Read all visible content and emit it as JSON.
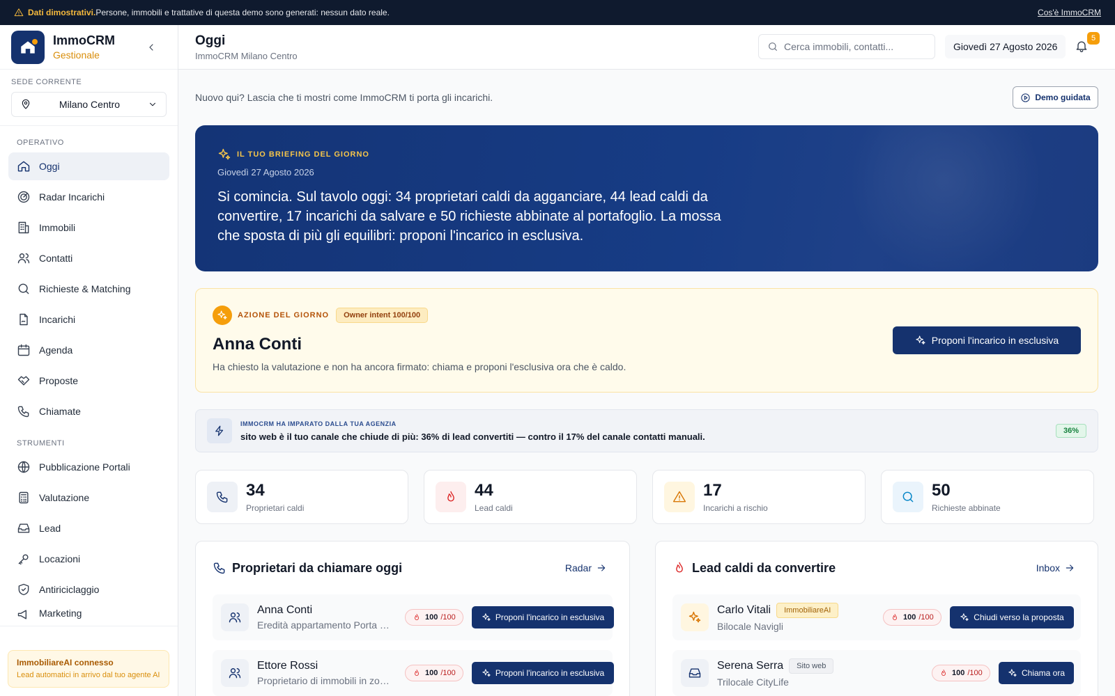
{
  "banner": {
    "strong": "Dati dimostrativi.",
    "text": " Persone, immobili e trattative di questa demo sono generati: nessun dato reale.",
    "link": "Cos'è ImmoCRM"
  },
  "sidebar": {
    "brand_name": "ImmoCRM",
    "brand_sub": "Gestionale",
    "sede_label": "SEDE CORRENTE",
    "sede_value": "Milano Centro",
    "section_operativo": "OPERATIVO",
    "operativo": [
      {
        "label": "Oggi",
        "icon": "home-icon"
      },
      {
        "label": "Radar Incarichi",
        "icon": "radar-icon"
      },
      {
        "label": "Immobili",
        "icon": "building-icon"
      },
      {
        "label": "Contatti",
        "icon": "users-icon"
      },
      {
        "label": "Richieste & Matching",
        "icon": "search-icon"
      },
      {
        "label": "Incarichi",
        "icon": "file-signature-icon"
      },
      {
        "label": "Agenda",
        "icon": "calendar-icon"
      },
      {
        "label": "Proposte",
        "icon": "handshake-icon"
      },
      {
        "label": "Chiamate",
        "icon": "phone-icon"
      }
    ],
    "section_strumenti": "STRUMENTI",
    "strumenti": [
      {
        "label": "Pubblicazione Portali",
        "icon": "globe-icon"
      },
      {
        "label": "Valutazione",
        "icon": "calculator-icon"
      },
      {
        "label": "Lead",
        "icon": "inbox-icon"
      },
      {
        "label": "Locazioni",
        "icon": "key-icon"
      },
      {
        "label": "Antiriciclaggio",
        "icon": "shield-icon"
      },
      {
        "label": "Marketing",
        "icon": "megaphone-icon"
      }
    ],
    "ai_title": "ImmobiliareAI connesso",
    "ai_desc": "Lead automatici in arrivo dal tuo agente AI"
  },
  "header": {
    "title": "Oggi",
    "subtitle": "ImmoCRM Milano Centro",
    "search_placeholder": "Cerca immobili, contatti...",
    "date": "Giovedì 27 Agosto 2026",
    "notifications": "5"
  },
  "intro": {
    "text": "Nuovo qui? Lascia che ti mostri come ImmoCRM ti porta gli incarichi.",
    "demo_button": "Demo guidata"
  },
  "briefing": {
    "label": "IL TUO BRIEFING DEL GIORNO",
    "date": "Giovedì 27 Agosto 2026",
    "text": "Si comincia. Sul tavolo oggi: 34 proprietari caldi da agganciare, 44 lead caldi da convertire, 17 incarichi da salvare e 50 richieste abbinate al portafoglio. La mossa che sposta di più gli equilibri: proponi l'incarico in esclusiva."
  },
  "azione": {
    "label": "AZIONE DEL GIORNO",
    "pill": "Owner intent 100/100",
    "name": "Anna Conti",
    "desc": "Ha chiesto la valutazione e non ha ancora firmato: chiama e proponi l'esclusiva ora che è caldo.",
    "button": "Proponi l'incarico in esclusiva"
  },
  "learn": {
    "label": "IMMOCRM HA IMPARATO DALLA TUA AGENZIA",
    "text": "sito web è il tuo canale che chiude di più: 36% di lead convertiti — contro il 17% del canale contatti manuali.",
    "pct": "36%"
  },
  "kpis": [
    {
      "value": "34",
      "label": "Proprietari caldi",
      "icon": "phone-icon",
      "bg": "#eef1f6",
      "fg": "#15326e"
    },
    {
      "value": "44",
      "label": "Lead caldi",
      "icon": "flame-icon",
      "bg": "#fdeeee",
      "fg": "#dc2626"
    },
    {
      "value": "17",
      "label": "Incarichi a rischio",
      "icon": "alert-triangle-icon",
      "bg": "#fff6e0",
      "fg": "#d97706"
    },
    {
      "value": "50",
      "label": "Richieste abbinate",
      "icon": "search-icon",
      "bg": "#eaf4fc",
      "fg": "#0284c7"
    }
  ],
  "panel_owners": {
    "title": "Proprietari da chiamare oggi",
    "link": "Radar",
    "rows": [
      {
        "name": "Anna Conti",
        "sub": "Eredità appartamento Porta Venezia",
        "score": "100",
        "max": "/100",
        "action": "Proponi l'incarico in esclusiva"
      },
      {
        "name": "Ettore Rossi",
        "sub": "Proprietario di immobili in zona",
        "score": "100",
        "max": "/100",
        "action": "Proponi l'incarico in esclusiva"
      }
    ]
  },
  "panel_leads": {
    "title": "Lead caldi da convertire",
    "link": "Inbox",
    "rows": [
      {
        "name": "Carlo Vitali",
        "tag": "ImmobiliareAI",
        "sub": "Bilocale Navigli",
        "score": "100",
        "max": "/100",
        "action": "Chiudi verso la proposta"
      },
      {
        "name": "Serena Serra",
        "tag": "Sito web",
        "sub": "Trilocale CityLife",
        "score": "100",
        "max": "/100",
        "action": "Chiama ora"
      }
    ]
  }
}
